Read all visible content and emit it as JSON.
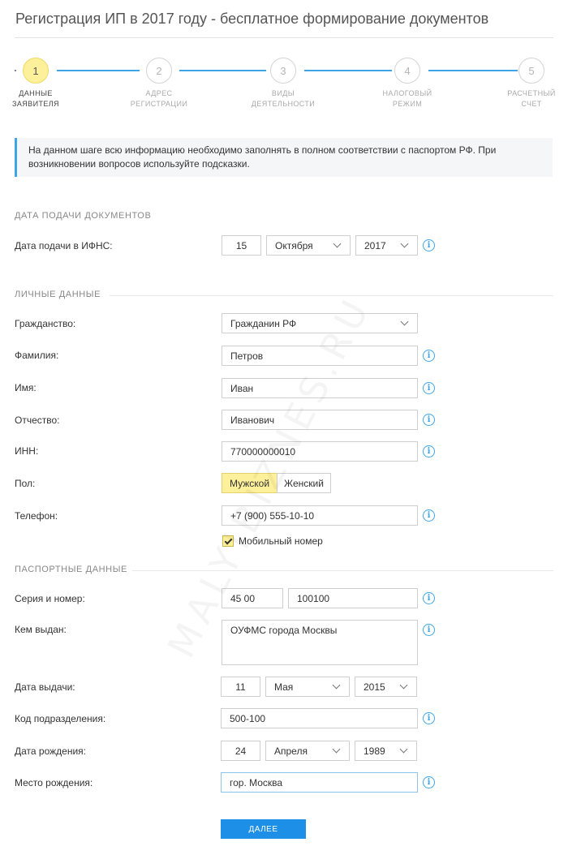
{
  "header": {
    "title": "Регистрация ИП в 2017 году - бесплатное формирование документов"
  },
  "steps": [
    {
      "number": "1",
      "line1": "Данные",
      "line2": "заявителя"
    },
    {
      "number": "2",
      "line1": "Адрес",
      "line2": "регистрации"
    },
    {
      "number": "3",
      "line1": "Виды",
      "line2": "деятельности"
    },
    {
      "number": "4",
      "line1": "Налоговый",
      "line2": "режим"
    },
    {
      "number": "5",
      "line1": "Расчетный",
      "line2": "счет"
    }
  ],
  "notice": "На данном шаге всю информацию необходимо заполнять в полном соответствии с паспортом РФ. При возникновении вопросов используйте подсказки.",
  "sections": {
    "filing": "Дата подачи документов",
    "personal": "Личные данные",
    "passport": "Паспортные данные"
  },
  "filing_date": {
    "label": "Дата подачи в ИФНС:",
    "day": "15",
    "month": "Октября",
    "year": "2017"
  },
  "citizenship": {
    "label": "Гражданство:",
    "value": "Гражданин РФ"
  },
  "surname": {
    "label": "Фамилия:",
    "value": "Петров"
  },
  "name": {
    "label": "Имя:",
    "value": "Иван"
  },
  "patronymic": {
    "label": "Отчество:",
    "value": "Иванович"
  },
  "inn": {
    "label": "ИНН:",
    "value": "770000000010"
  },
  "gender": {
    "label": "Пол:",
    "male": "Мужской",
    "female": "Женский"
  },
  "phone": {
    "label": "Телефон:",
    "value": "+7 (900) 555-10-10",
    "mobile_label": "Мобильный номер"
  },
  "passport": {
    "series_label": "Серия и номер:",
    "series": "45 00",
    "number": "100100",
    "issued_by_label": "Кем выдан:",
    "issued_by": "ОУФМС города Москвы",
    "issue_date_label": "Дата выдачи:",
    "issue_day": "11",
    "issue_month": "Мая",
    "issue_year": "2015",
    "code_label": "Код подразделения:",
    "code": "500-100",
    "birth_date_label": "Дата рождения:",
    "birth_day": "24",
    "birth_month": "Апреля",
    "birth_year": "1989",
    "birth_place_label": "Место рождения:",
    "birth_place": "гор. Москва"
  },
  "next_button": "ДАЛЕЕ",
  "watermark": "MALYIBIZNES.RU",
  "colors": {
    "accent": "#3ea6e6",
    "active": "#fdf09a",
    "button": "#1e8fe6"
  }
}
